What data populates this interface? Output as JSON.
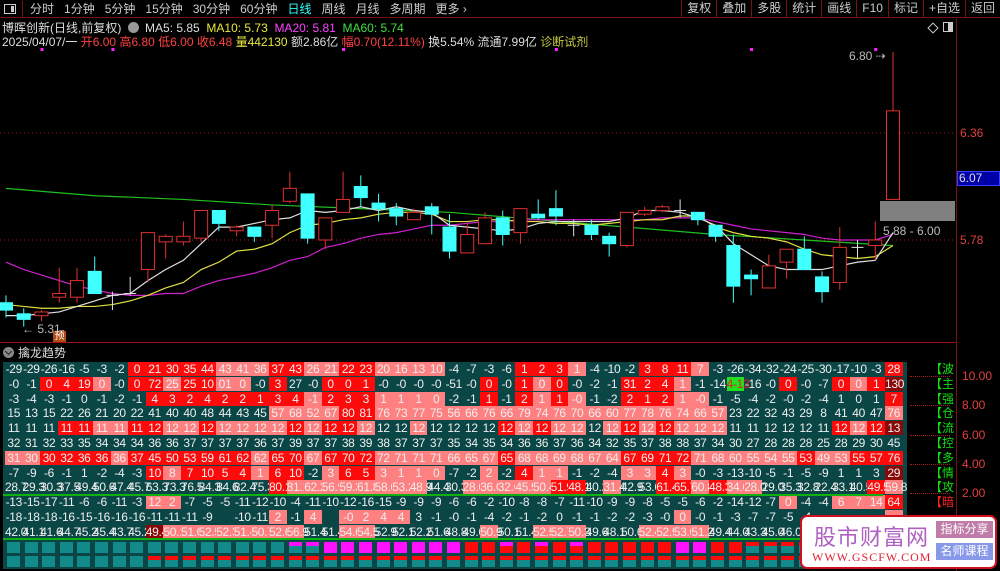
{
  "toolbar": {
    "periods": [
      "分时",
      "1分钟",
      "5分钟",
      "15分钟",
      "30分钟",
      "60分钟",
      "日线",
      "周线",
      "月线",
      "多周期",
      "更多 ›"
    ],
    "active_period": "日线",
    "buttons": [
      "复权",
      "叠加",
      "多股",
      "统计",
      "画线",
      "F10",
      "标记",
      "+自选",
      "返回"
    ]
  },
  "info": {
    "title": "博晖创新(日线,前复权)",
    "ma5": "MA5: 5.85",
    "ma10": "MA10: 5.73",
    "ma20": "MA20: 5.81",
    "ma60": "MA60: 5.74",
    "date": "2025/04/07/一",
    "open": "开6.00",
    "high": "高6.80",
    "low": "低6.00",
    "close": "收6.48",
    "volume": "量442130",
    "amount": "额2.86亿",
    "change": "幅0.70(12.11%)",
    "turnover": "换5.54%",
    "float": "流通7.99亿",
    "sector": "诊断试剂"
  },
  "chart": {
    "axis_labels": [
      "6.36",
      "5.78"
    ],
    "current_price": "6.07",
    "high_marker": "6.80",
    "low_marker": "5.31",
    "range_label": "5.88 - 6.00",
    "forecast_badge": "预",
    "colors": {
      "up": "#e03030",
      "down": "#40ffff",
      "ma5": "#e0e0e0",
      "ma10": "#e0e040",
      "ma20": "#d020d0",
      "ma60": "#20c020"
    }
  },
  "chart_data": {
    "type": "candlestick",
    "ohlc": [
      [
        5.44,
        5.48,
        5.36,
        5.4
      ],
      [
        5.38,
        5.41,
        5.31,
        5.35
      ],
      [
        5.37,
        5.4,
        5.34,
        5.39
      ],
      [
        5.47,
        5.63,
        5.44,
        5.49
      ],
      [
        5.47,
        5.63,
        5.44,
        5.56
      ],
      [
        5.61,
        5.69,
        5.49,
        5.49
      ],
      [
        5.48,
        5.5,
        5.4,
        5.48
      ],
      [
        5.49,
        5.58,
        5.48,
        5.49
      ],
      [
        5.62,
        5.82,
        5.55,
        5.82
      ],
      [
        5.77,
        5.81,
        5.68,
        5.8
      ],
      [
        5.77,
        5.88,
        5.75,
        5.8
      ],
      [
        5.79,
        5.94,
        5.77,
        5.94
      ],
      [
        5.94,
        5.94,
        5.83,
        5.87
      ],
      [
        5.83,
        5.86,
        5.8,
        5.85
      ],
      [
        5.85,
        5.85,
        5.77,
        5.8
      ],
      [
        5.86,
        5.97,
        5.79,
        5.94
      ],
      [
        5.99,
        6.15,
        5.98,
        6.06
      ],
      [
        6.03,
        6.03,
        5.76,
        5.79
      ],
      [
        5.78,
        5.9,
        5.73,
        5.9
      ],
      [
        5.93,
        6.15,
        5.93,
        6.0
      ],
      [
        6.07,
        6.13,
        5.96,
        6.01
      ],
      [
        5.98,
        6.03,
        5.88,
        5.95
      ],
      [
        5.95,
        5.98,
        5.86,
        5.91
      ],
      [
        5.89,
        5.95,
        5.89,
        5.93
      ],
      [
        5.96,
        5.98,
        5.81,
        5.92
      ],
      [
        5.85,
        5.92,
        5.68,
        5.72
      ],
      [
        5.71,
        5.87,
        5.71,
        5.81
      ],
      [
        5.76,
        5.93,
        5.76,
        5.9
      ],
      [
        5.9,
        5.94,
        5.75,
        5.81
      ],
      [
        5.82,
        5.95,
        5.76,
        5.95
      ],
      [
        5.92,
        6.0,
        5.89,
        5.9
      ],
      [
        5.95,
        6.05,
        5.86,
        5.91
      ],
      [
        5.86,
        5.89,
        5.8,
        5.86
      ],
      [
        5.86,
        5.89,
        5.78,
        5.81
      ],
      [
        5.8,
        5.82,
        5.69,
        5.76
      ],
      [
        5.75,
        5.93,
        5.74,
        5.93
      ],
      [
        5.92,
        5.96,
        5.91,
        5.94
      ],
      [
        5.94,
        5.97,
        5.93,
        5.96
      ],
      [
        5.94,
        6.0,
        5.9,
        5.94
      ],
      [
        5.93,
        5.93,
        5.86,
        5.89
      ],
      [
        5.86,
        5.86,
        5.77,
        5.8
      ],
      [
        5.75,
        5.81,
        5.44,
        5.53
      ],
      [
        5.59,
        5.62,
        5.48,
        5.57
      ],
      [
        5.52,
        5.7,
        5.52,
        5.64
      ],
      [
        5.66,
        5.73,
        5.57,
        5.73
      ],
      [
        5.73,
        5.8,
        5.62,
        5.62
      ],
      [
        5.58,
        5.61,
        5.44,
        5.5
      ],
      [
        5.55,
        5.85,
        5.51,
        5.74
      ],
      [
        5.74,
        5.78,
        5.68,
        5.74
      ],
      [
        5.75,
        5.88,
        5.67,
        5.78
      ],
      [
        6.0,
        6.8,
        6.0,
        6.48
      ]
    ],
    "ma5": [
      5.37,
      5.37,
      5.38,
      5.39,
      5.42,
      5.45,
      5.48,
      5.49,
      5.56,
      5.62,
      5.67,
      5.76,
      5.85,
      5.85,
      5.87,
      5.89,
      5.9,
      5.94,
      5.93,
      5.94,
      5.96,
      5.94,
      5.96,
      5.94,
      5.93,
      5.86,
      5.85,
      5.84,
      5.83,
      5.84,
      5.87,
      5.88,
      5.88,
      5.88,
      5.88,
      5.9,
      5.94,
      5.94,
      5.93,
      5.9,
      5.86,
      5.76,
      5.7,
      5.64,
      5.62,
      5.62,
      5.62,
      5.64,
      5.66,
      5.67,
      5.82
    ],
    "ma10": [
      5.43,
      5.42,
      5.41,
      5.41,
      5.42,
      5.42,
      5.43,
      5.45,
      5.48,
      5.52,
      5.55,
      5.62,
      5.66,
      5.72,
      5.73,
      5.76,
      5.82,
      5.86,
      5.87,
      5.89,
      5.9,
      5.92,
      5.93,
      5.93,
      5.92,
      5.88,
      5.88,
      5.89,
      5.89,
      5.88,
      5.88,
      5.87,
      5.87,
      5.86,
      5.87,
      5.88,
      5.89,
      5.89,
      5.91,
      5.91,
      5.85,
      5.82,
      5.8,
      5.79,
      5.77,
      5.73,
      5.7,
      5.69,
      5.68,
      5.69,
      5.75
    ],
    "ma20": [
      5.66,
      5.62,
      5.59,
      5.56,
      5.53,
      5.51,
      5.49,
      5.48,
      5.48,
      5.49,
      5.49,
      5.53,
      5.56,
      5.58,
      5.6,
      5.63,
      5.67,
      5.69,
      5.74,
      5.76,
      5.79,
      5.81,
      5.82,
      5.84,
      5.86,
      5.86,
      5.87,
      5.88,
      5.88,
      5.89,
      5.89,
      5.89,
      5.89,
      5.89,
      5.89,
      5.89,
      5.89,
      5.9,
      5.9,
      5.9,
      5.88,
      5.86,
      5.84,
      5.83,
      5.82,
      5.81,
      5.79,
      5.78,
      5.78,
      5.78,
      5.81
    ],
    "ma60_every5": [
      6.06,
      6.02,
      6.0,
      5.97,
      5.95,
      5.93,
      5.89,
      5.85,
      5.81,
      5.78,
      5.75
    ],
    "ylim": [
      5.25,
      6.85
    ]
  },
  "panel": {
    "title": "擒龙趋势",
    "axis_labels": [
      "10.00",
      "8.00",
      "6.00",
      "4.00",
      "2.00"
    ],
    "row_labels": [
      {
        "text": "【波",
        "color": "#10e010"
      },
      {
        "text": "【主",
        "color": "#10e010"
      },
      {
        "text": "【强",
        "color": "#10e010"
      },
      {
        "text": "【仓",
        "color": "#10e010"
      },
      {
        "text": "【流",
        "color": "#10e010"
      },
      {
        "text": "【控",
        "color": "#10e010"
      },
      {
        "text": "【多",
        "color": "#10e010"
      },
      {
        "text": "【情",
        "color": "#10e010"
      },
      {
        "text": "【攻",
        "color": "#10e010"
      },
      {
        "text": "【暗",
        "color": "#ff2020"
      }
    ],
    "cell_colors": {
      "n": "transparent",
      "r": "#ff0a0a",
      "p": "#ff8080",
      "d": "#8a0808",
      "g": "#20e020"
    },
    "rows": [
      {
        "v": [
          "-29",
          "-29",
          "-26",
          "-16",
          "-5",
          "-3",
          "-2",
          "0",
          "21",
          "30",
          "35",
          "44",
          "43",
          "41",
          "36",
          "37",
          "43",
          "26",
          "21",
          "22",
          "23",
          "20",
          "16",
          "13",
          "10",
          "-4",
          "-7",
          "-3",
          "-6",
          "1",
          "2",
          "3",
          "1",
          "-4",
          "-10",
          "-2",
          "3",
          "8",
          "11",
          "7",
          "-3",
          "-26",
          "-34",
          "-32",
          "-24",
          "-25",
          "-30",
          "-17",
          "-10",
          "-3",
          "28"
        ],
        "c": "nnnnnnnrrrrrppprrpprrppppnnnnrrrpnnnrrrpnnnnnnnnnnr"
      },
      {
        "v": [
          "-0",
          "-1",
          "0",
          "4",
          "19",
          "0",
          "-0",
          "0",
          "72",
          "25",
          "25",
          "10",
          "01",
          "0",
          "-0",
          "3",
          "27",
          "-0",
          "0",
          "0",
          "1",
          "-0",
          "-0",
          "-0",
          "-0",
          "-51",
          "-0",
          "0",
          "-0",
          "1",
          "0",
          "0",
          "-0",
          "-2",
          "-1",
          "31",
          "2",
          "4",
          "1",
          "-1",
          "-14",
          "4-13",
          "-16",
          "-0",
          "0",
          "-0",
          "-7",
          "0",
          "0",
          "1",
          "130"
        ],
        "c": "nnrrrpnrrprrppnrnnrrrnnnnnnrnrprnnnrrrpnngnnrnnrprd"
      },
      {
        "v": [
          "-3",
          "-4",
          "-3",
          "-1",
          "0",
          "-1",
          "-2",
          "-1",
          "4",
          "3",
          "2",
          "4",
          "2",
          "2",
          "1",
          "3",
          "4",
          "-1",
          "2",
          "3",
          "3",
          "1",
          "1",
          "1",
          "0",
          "-2",
          "-1",
          "1",
          "-1",
          "2",
          "1",
          "1",
          "-0",
          "-1",
          "-2",
          "2",
          "1",
          "2",
          "1",
          "-0",
          "-1",
          "-5",
          "-4",
          "-2",
          "-0",
          "-2",
          "-4",
          "1",
          "0",
          "1",
          "7"
        ],
        "c": "nnnnnnnnrrrrrrrrrprrrppppnnrnrprpnnrrrppnnnnnnnnnnr"
      },
      {
        "v": [
          "15",
          "13",
          "15",
          "22",
          "26",
          "21",
          "20",
          "22",
          "41",
          "40",
          "40",
          "48",
          "44",
          "43",
          "45",
          "57",
          "68",
          "52",
          "67",
          "80",
          "81",
          "76",
          "73",
          "77",
          "75",
          "56",
          "66",
          "76",
          "66",
          "79",
          "74",
          "76",
          "70",
          "66",
          "60",
          "77",
          "78",
          "76",
          "74",
          "66",
          "57",
          "23",
          "22",
          "32",
          "43",
          "29",
          "8",
          "41",
          "40",
          "47",
          "76"
        ],
        "c": "nnnnnnnnnnnnnnnpppprrppppppppppppppppppppnnnnnnnnnp"
      },
      {
        "v": [
          "11",
          "11",
          "11",
          "11",
          "11",
          "11",
          "11",
          "11",
          "12",
          "12",
          "12",
          "12",
          "12",
          "12",
          "12",
          "12",
          "12",
          "12",
          "12",
          "12",
          "12",
          "12",
          "12",
          "12",
          "12",
          "12",
          "12",
          "12",
          "12",
          "12",
          "12",
          "12",
          "12",
          "12",
          "12",
          "12",
          "12",
          "12",
          "12",
          "12",
          "12",
          "11",
          "11",
          "12",
          "12",
          "12",
          "11",
          "12",
          "12",
          "12",
          "13"
        ],
        "c": "nnnrrpprrpprpppprprrpnnpnnnnrprppnprprpppnnnnnnrprd"
      },
      {
        "v": [
          "32",
          "31",
          "32",
          "33",
          "35",
          "34",
          "34",
          "34",
          "36",
          "36",
          "37",
          "37",
          "37",
          "37",
          "36",
          "37",
          "39",
          "37",
          "37",
          "38",
          "39",
          "38",
          "37",
          "37",
          "37",
          "35",
          "34",
          "35",
          "34",
          "36",
          "36",
          "37",
          "36",
          "34",
          "32",
          "35",
          "37",
          "38",
          "38",
          "37",
          "34",
          "30",
          "27",
          "28",
          "28",
          "28",
          "25",
          "28",
          "29",
          "30",
          "45"
        ],
        "c": "nnnnnnnnnnnnnnnnnnnnnnnnnnnnnnnnnnnnnnnnnnnnnnnnnnn"
      },
      {
        "v": [
          "31",
          "30",
          "30",
          "32",
          "36",
          "36",
          "36",
          "37",
          "45",
          "50",
          "53",
          "59",
          "61",
          "62",
          "62",
          "65",
          "70",
          "67",
          "67",
          "70",
          "72",
          "72",
          "71",
          "71",
          "71",
          "66",
          "65",
          "67",
          "65",
          "68",
          "68",
          "69",
          "68",
          "67",
          "64",
          "67",
          "69",
          "71",
          "72",
          "71",
          "68",
          "60",
          "55",
          "54",
          "55",
          "53",
          "49",
          "53",
          "55",
          "57",
          "76"
        ],
        "c": "pprrrrprrrrrrrprrprrrppppppprpppppprrrrpppppprpprrrp"
      },
      {
        "v": [
          "-7",
          "-9",
          "-6",
          "-1",
          "1",
          "-2",
          "-4",
          "-3",
          "10",
          "8",
          "7",
          "10",
          "5",
          "4",
          "1",
          "6",
          "10",
          "-2",
          "3",
          "6",
          "5",
          "3",
          "1",
          "1",
          "0",
          "-7",
          "-2",
          "2",
          "-2",
          "4",
          "1",
          "1",
          "-1",
          "-2",
          "-4",
          "3",
          "3",
          "4",
          "3",
          "-0",
          "-3",
          "-13",
          "-10",
          "-5",
          "-1",
          "-5",
          "-9",
          "1",
          "1",
          "3",
          "29"
        ],
        "c": "nnnnnnnnrprrrrprrnprrppppnnpnrppnnnpprpnnnnnnnnnnnd"
      },
      {
        "v": [
          "28.7",
          "29.3",
          "30.3",
          "37.5",
          "49.4",
          "50.6",
          "47.4",
          "45.7",
          "63.3",
          "73.3",
          "76.5",
          "84.3",
          "84.6",
          "82.4",
          "75.3",
          "80.1",
          "81.1",
          "62.2",
          "56.9",
          "59.3",
          "61.8",
          "58.6",
          "53.2",
          "48.9",
          "44.4",
          "30.3",
          "28.6",
          "36.0",
          "32.6",
          "45.9",
          "50.4",
          "51.9",
          "48.1",
          "40.2",
          "31.4",
          "42.9",
          "53.6",
          "61.4",
          "65.7",
          "60.8",
          "48.3",
          "34.6",
          "28.0",
          "29.0",
          "35.3",
          "32.8",
          "22.4",
          "33.1",
          "40.5",
          "49.5",
          "59.8"
        ],
        "c": "nnnnnnnnnnnnnnnrppppppppnnppppprrnpnnrrprppnnnnnnrprp"
      },
      {
        "v": [
          "-13",
          "-15",
          "-17",
          "-11",
          "-6",
          "-6",
          "-11",
          "-3",
          "12",
          "2",
          "-7",
          "-5",
          "-5",
          "-11",
          "-12",
          "-10",
          "-4",
          "-11",
          "-10",
          "-12",
          "-16",
          "-15",
          "-9",
          "-9",
          "-9",
          "-6",
          "-6",
          "-2",
          "-10",
          "-8",
          "-8",
          "-7",
          "-11",
          "-10",
          "-9",
          "-9",
          "-8",
          "-5",
          "-5",
          "-6",
          "-2",
          "-14",
          "-12",
          "-7",
          "0",
          "-4",
          "-4",
          "6",
          "7",
          "14",
          "64"
        ],
        "c": "nnnnnnnnppnnnnnnnnnnnnnnnnnnnnnnnnnnnnnnnnnnpnnpppr"
      },
      {
        "v": [
          "-18",
          "-18",
          "-18",
          "-16",
          "-15",
          "-16",
          "-16",
          "-16",
          "-11",
          "-11",
          "-11",
          "-9",
          "",
          "-10",
          "-11",
          "2",
          "-1",
          "4",
          "",
          "-0",
          "2",
          "4",
          "4",
          "3",
          "-1",
          "-0",
          "-1",
          "-4",
          "-2",
          "-1",
          "-2",
          "0",
          "-1",
          "-1",
          "-2",
          "-2",
          "-3",
          "-0",
          "0",
          "-0",
          "-1",
          "-3",
          "-7",
          "-7",
          "-5",
          "-4",
          "",
          "",
          "",
          "",
          ""
        ],
        "c": "nnnnnnnnnnnnnnnpnpnppppnnnnnnnnnnnnnnnpnnnnnnnnnnnp"
      },
      {
        "v": [
          "42.0",
          "41.1",
          "41.6",
          "44.7",
          "45.2",
          "45.4",
          "43.7",
          "45.2",
          "49.4",
          "50.1",
          "51.0",
          "52.5",
          "52.3",
          "51.4",
          "50.7",
          "52.6",
          "56.9",
          "51.4",
          "51.4",
          "54.6",
          "54.5",
          "52.9",
          "52.1",
          "52.2",
          "51.6",
          "48.8",
          "49.6",
          "50.9",
          "50.1",
          "51.4",
          "52.5",
          "52.7",
          "50.3",
          "49.6",
          "48.1",
          "50.6",
          "52.4",
          "52.9",
          "53.0",
          "51.2",
          "49.4",
          "44.0",
          "43.3",
          "45.0",
          "46.0",
          "",
          "",
          "",
          "",
          "",
          ""
        ],
        "c": "nnnnnnnndppppppppnnppnnnnnnpnnpppnnnppppnnnnnnnnnnn"
      }
    ],
    "square_rows": [
      "ttttttttttttttttaammmmmmmmrrbrbrbrrrrrmmrrcccctttttt",
      "ttttttttccccccccccccccccccccccccccccccccccccccccccc"
    ],
    "square_colors": {
      "teal": "#138a8a",
      "magenta": "#ff10ff",
      "red": "#ff0a0a"
    }
  },
  "watermark": {
    "title": "股市财富网",
    "url": "WWW.GSCFW.COM",
    "btn1": "指标分享",
    "btn2": "名师课程"
  }
}
